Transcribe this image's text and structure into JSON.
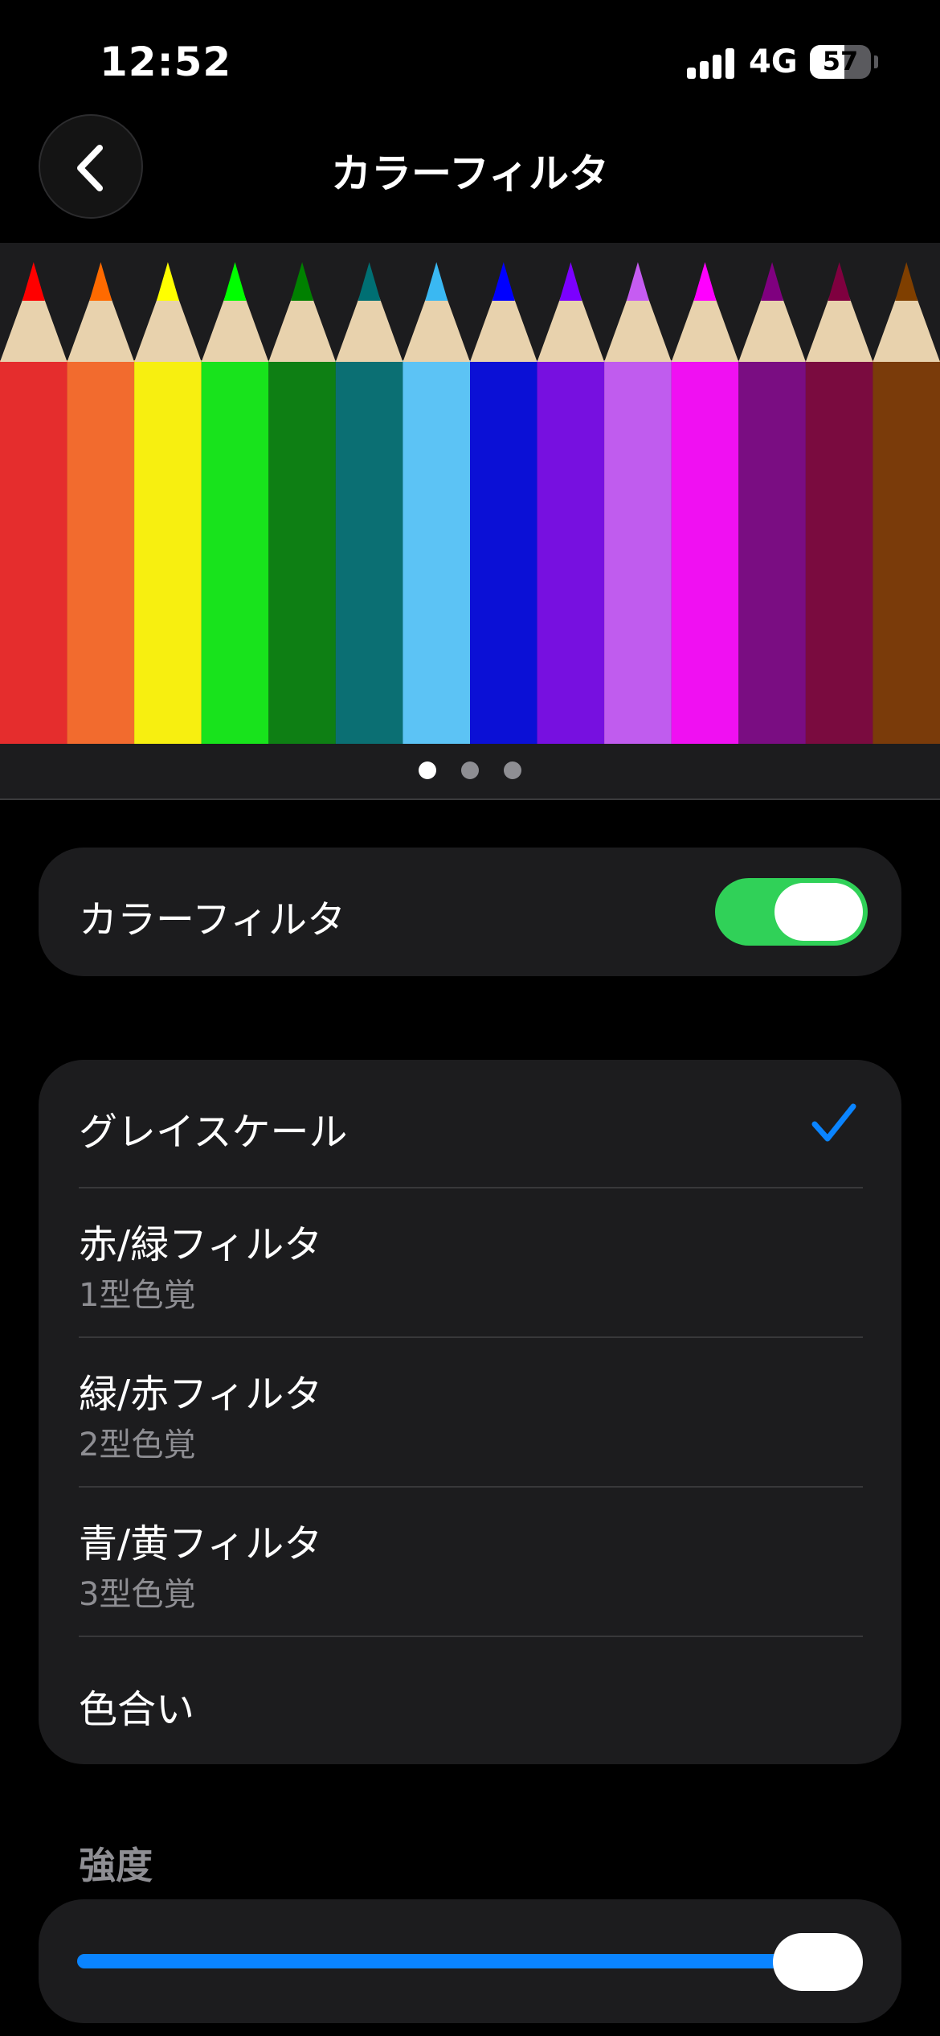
{
  "status_bar": {
    "time": "12:52",
    "network": "4G",
    "battery": "57",
    "battery_level": 0.57
  },
  "nav": {
    "title": "カラーフィルタ",
    "back_icon": "chevron-left-icon"
  },
  "banner": {
    "image": "colored-pencils",
    "pencil_colors": [
      "#e52d2d",
      "#f26b2e",
      "#f7ef10",
      "#18e31c",
      "#0e7f14",
      "#0b6f73",
      "#5cc3f5",
      "#0b10d6",
      "#7710e0",
      "#c05cee",
      "#f010f2",
      "#7a0d82",
      "#7a0b3f",
      "#7a3b0a"
    ],
    "tip_colors": [
      "#ff0000",
      "#ff6a00",
      "#ffff00",
      "#00ff00",
      "#008000",
      "#006f73",
      "#3ab8f2",
      "#0000ff",
      "#7b00ff",
      "#c65cf2",
      "#ff00ff",
      "#7f007f",
      "#7f003f",
      "#7f3f00"
    ],
    "pages": 3,
    "active_page": 1
  },
  "color_filter": {
    "label": "カラーフィルタ",
    "enabled": true
  },
  "filters": [
    {
      "title": "グレイスケール",
      "subtitle": "",
      "selected": true
    },
    {
      "title": "赤/緑フィルタ",
      "subtitle": "1型色覚",
      "selected": false
    },
    {
      "title": "緑/赤フィルタ",
      "subtitle": "2型色覚",
      "selected": false
    },
    {
      "title": "青/黄フィルタ",
      "subtitle": "3型色覚",
      "selected": false
    },
    {
      "title": "色合い",
      "subtitle": "",
      "selected": false
    }
  ],
  "intensity": {
    "header": "強度",
    "value": 1.0
  },
  "colors": {
    "accent": "#0a84ff",
    "toggle_on": "#30d158",
    "card_bg": "#1c1c1e",
    "secondary_text": "#8e8e93"
  }
}
